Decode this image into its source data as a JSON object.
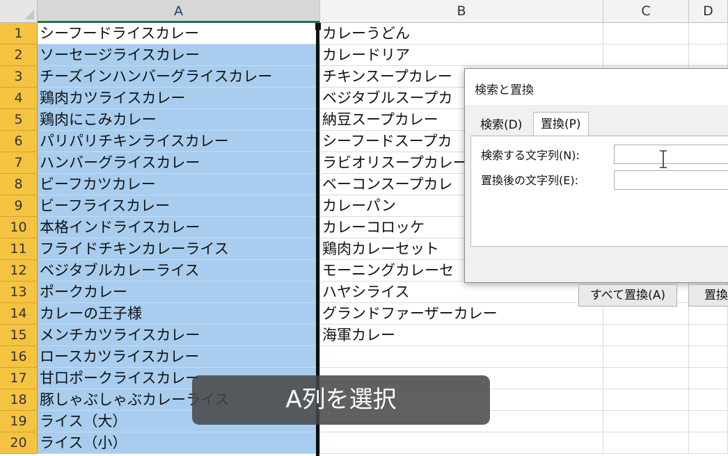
{
  "columns": [
    "A",
    "B",
    "C",
    "D"
  ],
  "rows": [
    {
      "n": "1",
      "a": "シーフードライスカレー",
      "b": "カレーうどん"
    },
    {
      "n": "2",
      "a": "ソーセージライスカレー",
      "b": "カレードリア"
    },
    {
      "n": "3",
      "a": "チーズインハンバーグライスカレー",
      "b": "チキンスープカレー"
    },
    {
      "n": "4",
      "a": "鶏肉カツライスカレー",
      "b": "ベジタブルスープカ"
    },
    {
      "n": "5",
      "a": "鶏肉にこみカレー",
      "b": "納豆スープカレー"
    },
    {
      "n": "6",
      "a": "パリパリチキンライスカレー",
      "b": "シーフードスープカ"
    },
    {
      "n": "7",
      "a": "ハンバーグライスカレー",
      "b": "ラビオリスープカレー"
    },
    {
      "n": "8",
      "a": "ビーフカツカレー",
      "b": "ベーコンスープカレ"
    },
    {
      "n": "9",
      "a": "ビーフライスカレー",
      "b": "カレーパン"
    },
    {
      "n": "10",
      "a": "本格インドライスカレー",
      "b": "カレーコロッケ"
    },
    {
      "n": "11",
      "a": "フライドチキンカレーライス",
      "b": "鶏肉カレーセット"
    },
    {
      "n": "12",
      "a": "ベジタブルカレーライス",
      "b": "モーニングカレーセ"
    },
    {
      "n": "13",
      "a": "ポークカレー",
      "b": "ハヤシライス"
    },
    {
      "n": "14",
      "a": "カレーの王子様",
      "b": "グランドファーザーカレー"
    },
    {
      "n": "15",
      "a": "メンチカツライスカレー",
      "b": "海軍カレー"
    },
    {
      "n": "16",
      "a": "ロースカツライスカレー",
      "b": ""
    },
    {
      "n": "17",
      "a": "甘口ポークライスカレー",
      "b": ""
    },
    {
      "n": "18",
      "a": "豚しゃぶしゃぶカレーライス",
      "b": ""
    },
    {
      "n": "19",
      "a": "ライス（大）",
      "b": ""
    },
    {
      "n": "20",
      "a": "ライス（小）",
      "b": ""
    }
  ],
  "dialog": {
    "title": "検索と置換",
    "tabs": [
      "検索(D)",
      "置換(P)"
    ],
    "find_label": "検索する文字列(N):",
    "replace_label": "置換後の文字列(E):",
    "find_value": "",
    "replace_value": "",
    "replace_all_button": "すべて置換(A)",
    "replace_button": "置換"
  },
  "overlay_caption": "A列を選択",
  "colors": {
    "selection": "#a8cdee",
    "row_header": "#f5c342",
    "overlay": "#464646"
  }
}
